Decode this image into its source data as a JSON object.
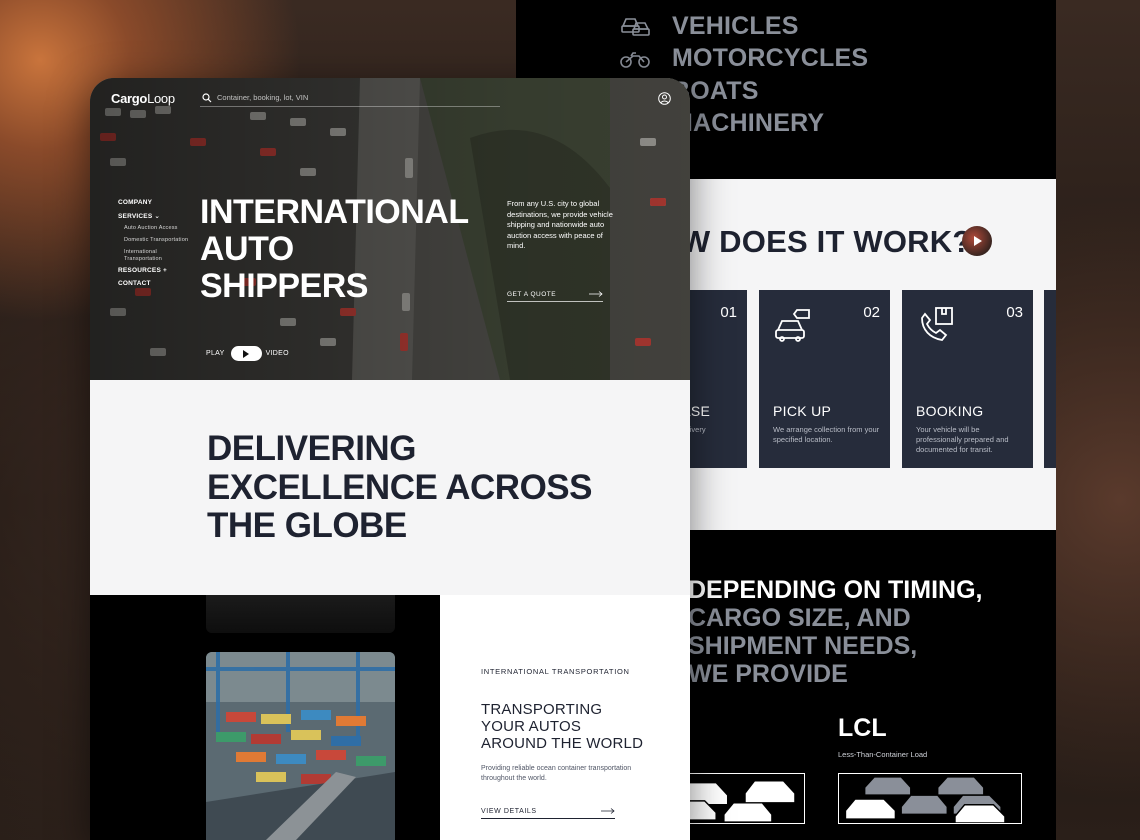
{
  "brand": {
    "logo_part1": "Cargo",
    "logo_part2": "Loop"
  },
  "search": {
    "placeholder": "Container, booking, lot, VIN"
  },
  "nav": {
    "company": "COMPANY",
    "services": "SERVICES",
    "services_chevron": "⌄",
    "sub_items": [
      "Auto Auction Access",
      "Domestic Transportation",
      "International Transportation"
    ],
    "resources": "RESOURCES",
    "resources_plus": "+",
    "contact": "CONTACT"
  },
  "hero": {
    "title_lines": [
      "INTERNATIONAL",
      "AUTO",
      "SHIPPERS"
    ],
    "description": "From any U.S. city to global destinations, we provide vehicle shipping and nationwide auto auction access with peace of mind.",
    "cta_label": "GET A QUOTE",
    "play_label": "PLAY",
    "video_label": "VIDEO"
  },
  "delivering": {
    "lines": [
      "DELIVERING",
      "EXCELLENCE ACROSS",
      "THE GLOBE"
    ]
  },
  "transport": {
    "kicker": "INTERNATIONAL TRANSPORTATION",
    "title_lines": [
      "TRANSPORTING",
      "YOUR AUTOS",
      "AROUND THE WORLD"
    ],
    "description": "Providing reliable ocean container transportation throughout the world.",
    "link_label": "VIEW DETAILS"
  },
  "categories": [
    {
      "label": "VEHICLES",
      "icon": "vehicles-icon"
    },
    {
      "label": "MOTORCYCLES",
      "icon": "motorcycle-icon"
    },
    {
      "label": "BOATS",
      "icon": "boat-icon"
    },
    {
      "label": "MACHINERY",
      "icon": "machinery-icon"
    }
  ],
  "how": {
    "title": "HOW DOES IT WORK?",
    "steps": [
      {
        "num": "",
        "title": "PURCHASE",
        "desc": "You buy to... ...delivery"
      },
      {
        "num": "02",
        "title": "PICK UP",
        "desc": "We arrange collection from your specified location."
      },
      {
        "num": "03",
        "title": "BOOKING",
        "desc": "Your vehicle will be professionally prepared and documented for transit."
      }
    ]
  },
  "depend": {
    "line1": "DEPENDING ON TIMING,",
    "line2": "CARGO SIZE, AND",
    "line3": "SHIPMENT NEEDS,",
    "line4": "WE PROVIDE"
  },
  "lcl": {
    "title": "LCL",
    "subtitle": "Less-Than-Container Load"
  },
  "colors": {
    "navy": "#1e2230",
    "card": "#262c3b",
    "grey_text": "#8a8f99"
  }
}
